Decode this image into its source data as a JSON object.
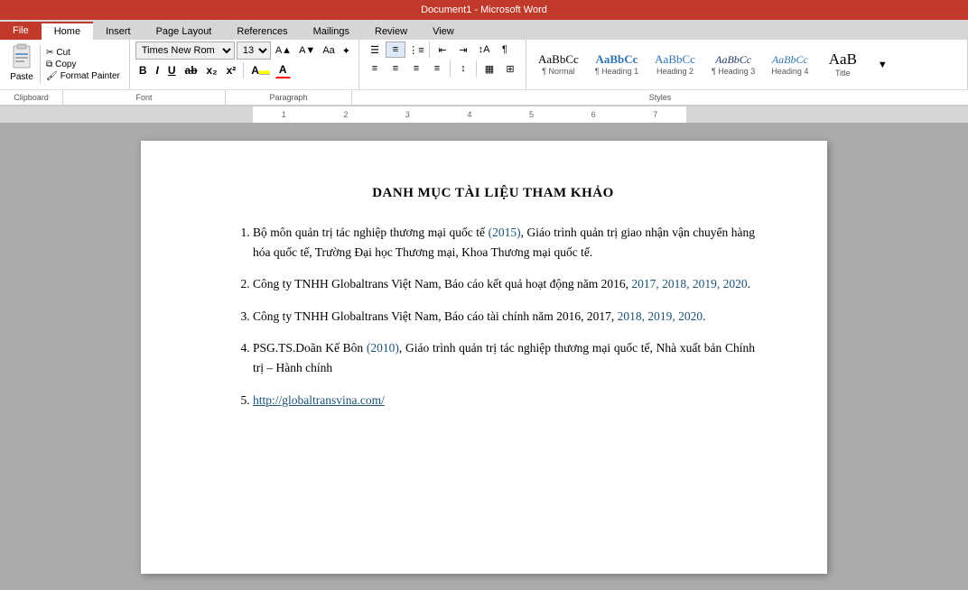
{
  "window": {
    "title": "Document1 - Microsoft Word"
  },
  "tabs": [
    {
      "id": "file",
      "label": "File",
      "active": false
    },
    {
      "id": "home",
      "label": "Home",
      "active": true
    },
    {
      "id": "insert",
      "label": "Insert",
      "active": false
    },
    {
      "id": "page-layout",
      "label": "Page Layout",
      "active": false
    },
    {
      "id": "references",
      "label": "References",
      "active": false
    },
    {
      "id": "mailings",
      "label": "Mailings",
      "active": false
    },
    {
      "id": "review",
      "label": "Review",
      "active": false
    },
    {
      "id": "view",
      "label": "View",
      "active": false
    }
  ],
  "clipboard": {
    "paste_label": "Paste",
    "cut_label": "Cut",
    "copy_label": "Copy",
    "format_painter_label": "Format Painter",
    "group_label": "Clipboard"
  },
  "font": {
    "family": "Times New Rom",
    "size": "13",
    "group_label": "Font"
  },
  "paragraph": {
    "group_label": "Paragraph"
  },
  "styles": {
    "group_label": "Styles",
    "items": [
      {
        "id": "normal",
        "preview": "AaBbCc",
        "label": "¶ Normal",
        "size": 11
      },
      {
        "id": "heading1",
        "preview": "AaBbCc",
        "label": "¶ Heading 1",
        "size": 11,
        "color": "#2e74b5"
      },
      {
        "id": "heading2",
        "preview": "AaBbCc",
        "label": "Heading 2",
        "size": 11,
        "color": "#2e74b5"
      },
      {
        "id": "heading3",
        "preview": "AaBbCc",
        "label": "¶ Heading 3",
        "size": 11,
        "color": "#1f3864"
      },
      {
        "id": "heading4",
        "preview": "AaBbCc",
        "label": "Heading 4",
        "size": 11,
        "color": "#2e74b5"
      },
      {
        "id": "title",
        "preview": "AaB",
        "label": "Title",
        "size": 16
      }
    ]
  },
  "document": {
    "title": "DANH MỤC TÀI LIỆU THAM KHẢO",
    "references": [
      {
        "id": 1,
        "text": "Bộ môn quản trị tác nghiệp thương mại quốc tế ",
        "year": "(2015)",
        "rest": ", Giáo trình quản trị giao nhận vận chuyển hàng hóa quốc tế, Trường Đại học Thương mại, Khoa Thương mại quốc tế."
      },
      {
        "id": 2,
        "text": "Công ty TNHH Globaltrans Việt Nam, Báo cáo kết quả hoạt động năm 2016, ",
        "year": "2017, 2018, 2019, 2020",
        "rest": "."
      },
      {
        "id": 3,
        "text": "Công ty TNHH Globaltrans Việt Nam, Báo cáo tài chính năm 2016, 2017, ",
        "year": "2018, 2019, 2020",
        "rest": "."
      },
      {
        "id": 4,
        "text": "PSG.TS.Doãn Kế Bôn ",
        "year": "(2010)",
        "rest": ", Giáo trình quản trị tác nghiệp thương mại quốc tế, Nhà xuất bản Chính trị – Hành chính"
      },
      {
        "id": 5,
        "link": "http://globaltransvina.com/"
      }
    ]
  }
}
